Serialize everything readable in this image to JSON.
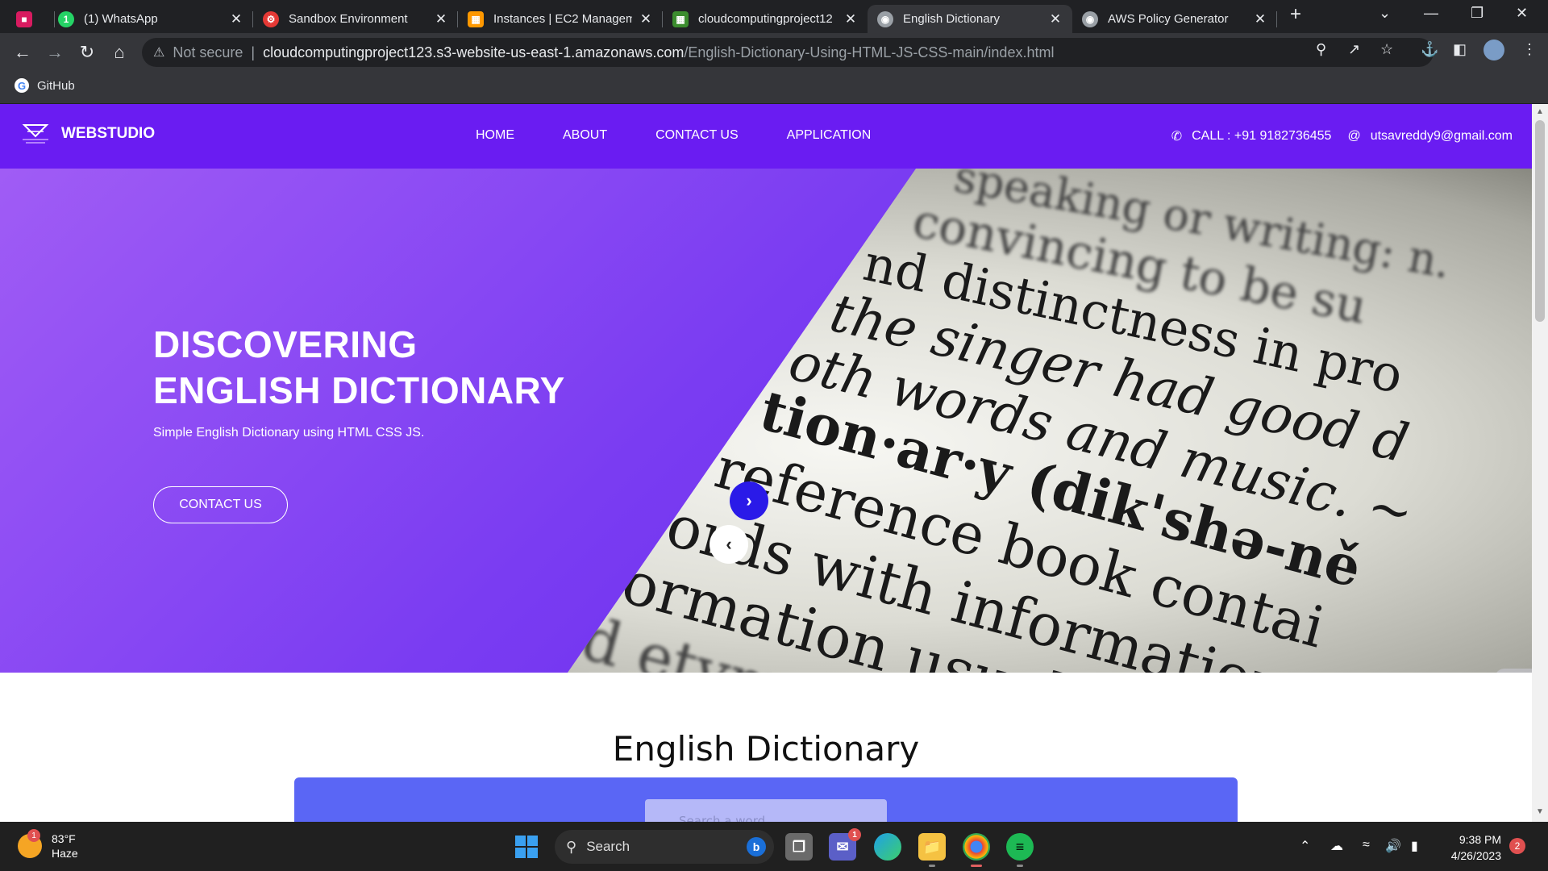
{
  "browser": {
    "tabs": [
      {
        "title": "",
        "favicon": "app-icon",
        "color": "#d81b60"
      },
      {
        "title": "(1) WhatsApp",
        "favicon": "whatsapp-icon",
        "color": "#25d366"
      },
      {
        "title": "Sandbox Environment",
        "favicon": "sandbox-icon",
        "color": "#e53935"
      },
      {
        "title": "Instances | EC2 Manageme",
        "favicon": "aws-icon",
        "color": "#ff9900"
      },
      {
        "title": "cloudcomputingproject12",
        "favicon": "s3-icon",
        "color": "#3c8d2f"
      },
      {
        "title": "English Dictionary",
        "favicon": "globe-icon",
        "color": "#9aa0a6"
      },
      {
        "title": "AWS Policy Generator",
        "favicon": "globe-icon",
        "color": "#9aa0a6"
      }
    ],
    "active_tab": 5,
    "security_label": "Not secure",
    "url_host": "cloudcomputingproject123.s3-website-us-east-1.amazonaws.com",
    "url_path": "/English-Dictionary-Using-HTML-JS-CSS-main/index.html",
    "bookmarks": [
      {
        "label": "GitHub"
      }
    ]
  },
  "site": {
    "brand": "WEBSTUDIO",
    "nav": [
      "HOME",
      "ABOUT",
      "CONTACT US",
      "APPLICATION"
    ],
    "phone": "CALL : +91 9182736455",
    "email": "utsavreddy9@gmail.com",
    "hero": {
      "title_line1": "DISCOVERING",
      "title_line2": "ENGLISH DICTIONARY",
      "subtitle": "Simple English Dictionary using HTML CSS JS.",
      "button": "CONTACT US",
      "image_text": [
        "speaking or writing: n.",
        "convincing to be su",
        "nd distinctness in pro",
        "the singer had good d",
        "oth words and music. ~",
        "tion·ar·y (dik'shə-ně",
        "reference book contai",
        "ords with information",
        "ormation usually in",
        "d etymology"
      ]
    },
    "section_title": "English Dictionary",
    "search_placeholder": "Search a word"
  },
  "taskbar": {
    "weather_temp": "83°F",
    "weather_desc": "Haze",
    "weather_badge": "1",
    "search_label": "Search",
    "time": "9:38 PM",
    "date": "4/26/2023",
    "notifications": "2",
    "teams_badge": "1"
  },
  "colors": {
    "header_purple": "#6a1cf2",
    "hero_gradient_start": "#a05cf5",
    "hero_gradient_end": "#5d20e8",
    "card_blue": "#5a66f5"
  }
}
